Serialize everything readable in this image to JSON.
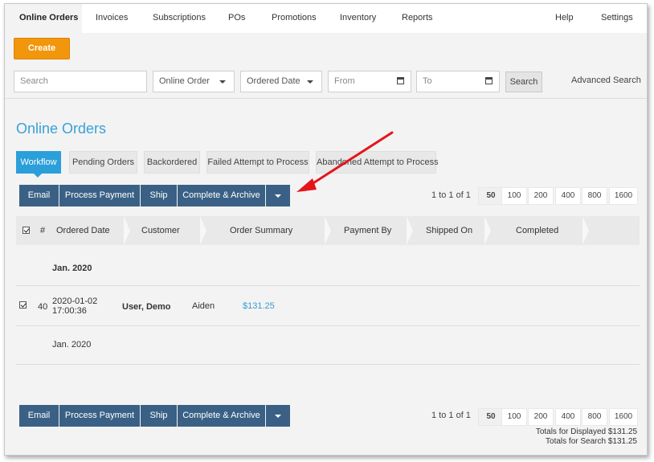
{
  "nav": {
    "items": [
      {
        "label": "Online Orders",
        "active": true
      },
      {
        "label": "Invoices"
      },
      {
        "label": "Subscriptions"
      },
      {
        "label": "POs"
      },
      {
        "label": "Promotions"
      },
      {
        "label": "Inventory"
      },
      {
        "label": "Reports"
      }
    ],
    "help": "Help",
    "settings": "Settings"
  },
  "toolbar": {
    "create_label": "Create",
    "search_placeholder": "Search",
    "order_type": "Online Order",
    "date_field": "Ordered Date",
    "from_placeholder": "From",
    "to_placeholder": "To",
    "search_button": "Search",
    "advanced_search": "Advanced Search"
  },
  "page": {
    "title": "Online Orders"
  },
  "tabs": [
    {
      "label": "Workflow",
      "active": true
    },
    {
      "label": "Pending Orders"
    },
    {
      "label": "Backordered"
    },
    {
      "label": "Failed Attempt to Process"
    },
    {
      "label": "Abandoned Attempt to Process"
    }
  ],
  "actions": {
    "email": "Email",
    "process_payment": "Process Payment",
    "ship": "Ship",
    "complete_archive": "Complete & Archive"
  },
  "pager": {
    "info": "1 to 1 of 1",
    "sizes": [
      "50",
      "100",
      "200",
      "400",
      "800",
      "1600"
    ],
    "selected": "50"
  },
  "table": {
    "columns": [
      "#",
      "Ordered Date",
      "Customer",
      "Order Summary",
      "Payment By",
      "Shipped On",
      "Completed"
    ],
    "group_header": "Jan. 2020",
    "rows": [
      {
        "num": "40",
        "date_line1": "2020-01-02",
        "date_line2": "17:00:36",
        "customer": "User, Demo",
        "summary": "Aiden",
        "amount": "$131.25"
      }
    ],
    "group_footer": "Jan. 2020"
  },
  "totals": {
    "displayed": "Totals for Displayed $131.25",
    "search": "Totals for Search $131.25"
  },
  "colors": {
    "accent": "#2b9fd9",
    "action": "#3a6185",
    "create": "#f2960b",
    "annotation_arrow": "#e5141b"
  }
}
